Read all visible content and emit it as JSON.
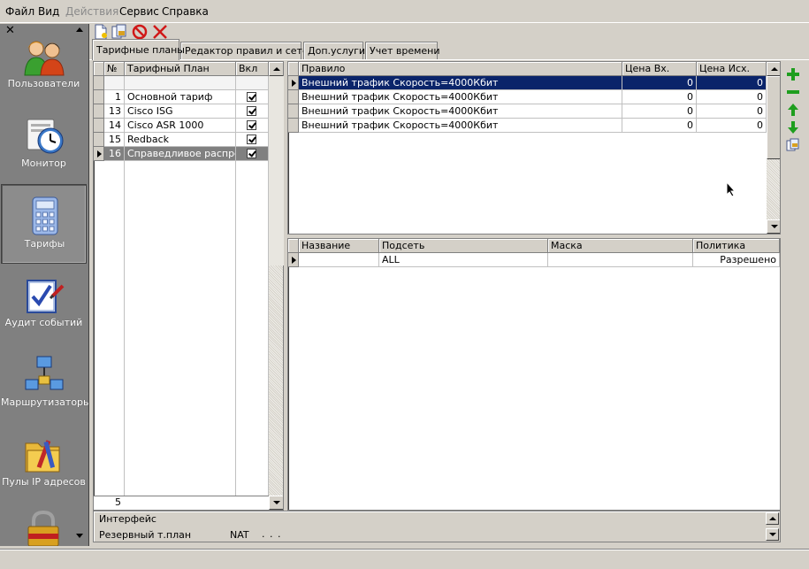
{
  "menu": [
    "Файл",
    "Вид",
    "Действия",
    "Сервис",
    "Справка"
  ],
  "sidebar": {
    "close": "✕",
    "items": [
      {
        "label": "Пользователи",
        "icon": "users-icon"
      },
      {
        "label": "Монитор",
        "icon": "monitor-clock-icon"
      },
      {
        "label": "Тарифы",
        "icon": "calculator-icon"
      },
      {
        "label": "Аудит событий",
        "icon": "audit-checklist-icon"
      },
      {
        "label": "Маршрутизаторы",
        "icon": "network-routers-icon"
      },
      {
        "label": "Пулы IP адресов",
        "icon": "ip-pools-icon"
      }
    ]
  },
  "tabs": [
    "Тарифные планы",
    "Редактор правил и сетей",
    "Доп.услуги",
    "Учет времени"
  ],
  "plans": {
    "columns": [
      "№",
      "Тарифный План",
      "Вкл"
    ],
    "rows": [
      {
        "id": "1",
        "name": "Основной тариф",
        "on": true
      },
      {
        "id": "13",
        "name": "Cisco ISG",
        "on": true
      },
      {
        "id": "14",
        "name": "Cisco ASR 1000",
        "on": true
      },
      {
        "id": "15",
        "name": "Redback",
        "on": true
      },
      {
        "id": "16",
        "name": "Справедливое распреде",
        "on": true
      }
    ],
    "footer_count": "5"
  },
  "rules": {
    "columns": [
      "Правило",
      "Цена Вх.",
      "Цена Исх."
    ],
    "rows": [
      {
        "rule": "Внешний трафик  Скорость=4000Кбит",
        "in": "0",
        "out": "0"
      },
      {
        "rule": "Внешний трафик  Скорость=4000Кбит",
        "in": "0",
        "out": "0"
      },
      {
        "rule": "Внешний трафик  Скорость=4000Кбит",
        "in": "0",
        "out": "0"
      },
      {
        "rule": "Внешний трафик  Скорость=4000Кбит",
        "in": "0",
        "out": "0"
      }
    ]
  },
  "nets": {
    "columns": [
      "Название",
      "Подсеть",
      "Маска",
      "Политика"
    ],
    "rows": [
      {
        "name": "",
        "subnet": "ALL",
        "mask": "",
        "policy": "Разрешено"
      }
    ]
  },
  "bottom": {
    "interface_label": "Интерфейс",
    "reserve_label": "Резервный т.план",
    "nat_label": "NAT",
    "nat_value": ". . ."
  },
  "colors": {
    "selection": "#0a246a",
    "sidebar": "#808080",
    "add": "#1e9e1e",
    "remove": "#cc1010"
  }
}
